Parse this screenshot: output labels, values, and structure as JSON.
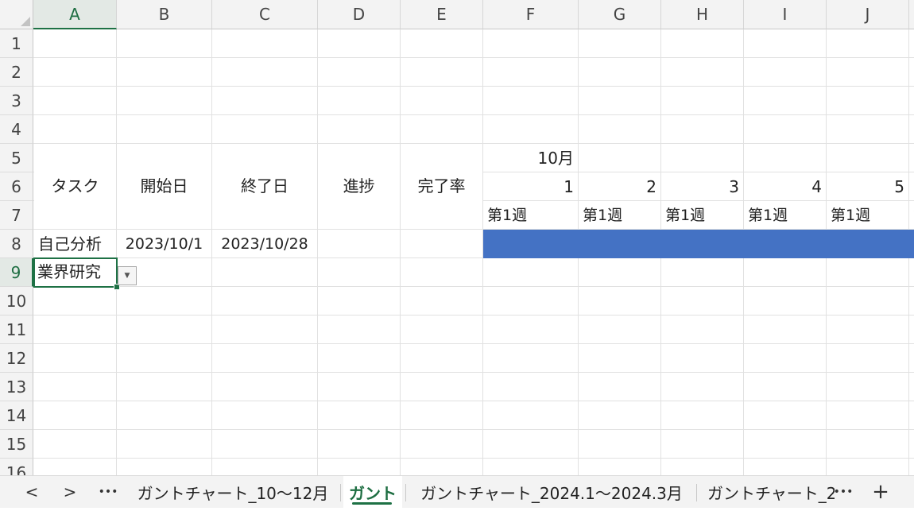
{
  "columns": [
    "A",
    "B",
    "C",
    "D",
    "E",
    "F",
    "G",
    "H",
    "I",
    "J"
  ],
  "rows": [
    "1",
    "2",
    "3",
    "4",
    "5",
    "6",
    "7",
    "8",
    "9",
    "10",
    "11",
    "12",
    "13",
    "14",
    "15",
    "16"
  ],
  "selected": {
    "column": "A",
    "row": "9"
  },
  "header_row": {
    "task": "タスク",
    "start_date": "開始日",
    "end_date": "終了日",
    "progress": "進捗",
    "completion": "完了率"
  },
  "timeline": {
    "month": "10月",
    "days": [
      "1",
      "2",
      "3",
      "4",
      "5"
    ],
    "weeks": [
      "第1週",
      "第1週",
      "第1週",
      "第1週",
      "第1週"
    ]
  },
  "tasks": [
    {
      "name": "自己分析",
      "start": "2023/10/1",
      "end": "2023/10/28"
    },
    {
      "name": "業界研究"
    }
  ],
  "dropdown_icon": "chevron-down-icon",
  "gantt_bar_color": "#4472c4",
  "accent_color": "#1e7145",
  "sheet_tabs": {
    "prev": "<",
    "next": ">",
    "more_left": "•••",
    "tab1": "ガントチャート_10～12月",
    "tab2": "ガント",
    "tab3": "ガントチャート_2024.1～2024.3月",
    "tab4": "ガントチャート_2",
    "more_right": "•••",
    "add": "+"
  }
}
